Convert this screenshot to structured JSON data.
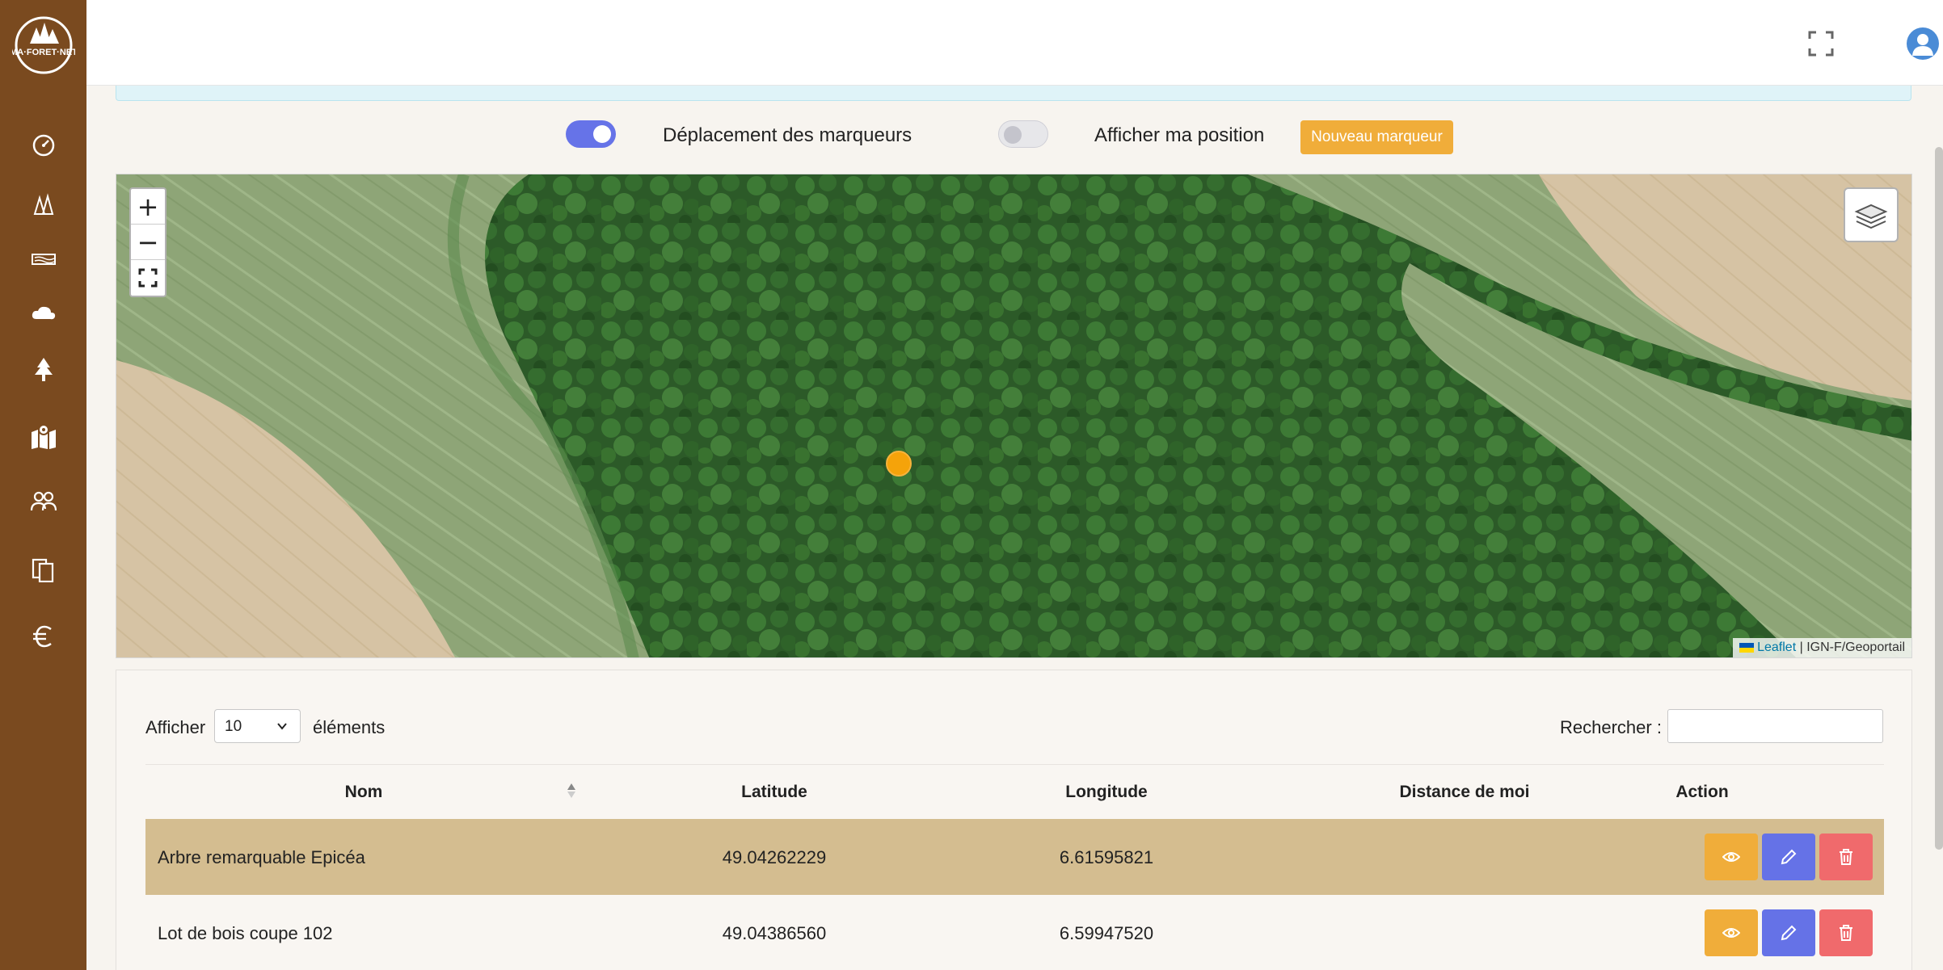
{
  "app": {
    "logo_text": "MA·FORET·NET"
  },
  "sidebar": {
    "items": [
      {
        "icon": "dashboard-gauge-icon"
      },
      {
        "icon": "forest-trees-icon"
      },
      {
        "icon": "wood-logs-icon"
      },
      {
        "icon": "weather-cloud-icon"
      },
      {
        "icon": "fir-tree-icon"
      },
      {
        "icon": "map-marker-icon"
      },
      {
        "icon": "users-icon"
      },
      {
        "icon": "documents-icon"
      },
      {
        "icon": "euro-icon"
      }
    ]
  },
  "header": {
    "fullscreen_icon": "fullscreen-icon",
    "avatar_icon": "user-avatar-icon",
    "chevron_icon": "chevron-down-icon"
  },
  "controls": {
    "move_markers_label": "Déplacement des marqueurs",
    "move_markers_on": true,
    "show_position_label": "Afficher ma position",
    "show_position_on": false,
    "new_marker_button": "Nouveau marqueur"
  },
  "map": {
    "zoom_in": "+",
    "zoom_out": "−",
    "attribution_link": "Leaflet",
    "attribution_rest": " | IGN-F/Geoportail",
    "marker_color": "#f5a30a"
  },
  "table": {
    "length_label": "Afficher",
    "length_value": "10",
    "length_suffix": "éléments",
    "search_label": "Rechercher :",
    "columns": [
      "Nom",
      "Latitude",
      "Longitude",
      "Distance de moi",
      "Action"
    ],
    "rows": [
      {
        "nom": "Arbre remarquable Epicéa",
        "latitude": "49.04262229",
        "longitude": "6.61595821",
        "distance": ""
      },
      {
        "nom": "Lot de bois coupe 102",
        "latitude": "49.04386560",
        "longitude": "6.59947520",
        "distance": ""
      }
    ]
  },
  "colors": {
    "sidebar": "#7a4a1f",
    "accent_orange": "#f0ad3a",
    "accent_blue": "#6572e7",
    "accent_red": "#f06a6c",
    "row_highlight": "#d4bd90"
  }
}
